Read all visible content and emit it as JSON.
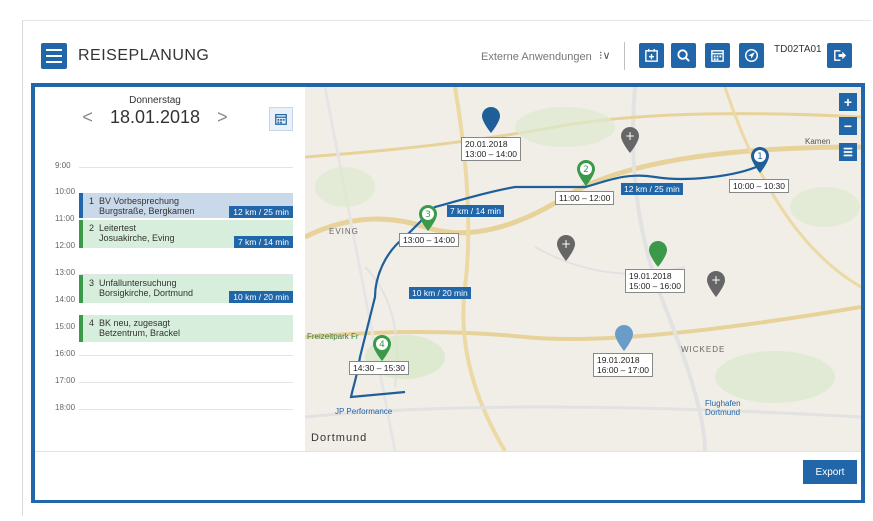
{
  "header": {
    "title": "REISEPLANUNG",
    "external_apps_label": "Externe Anwendungen",
    "external_apps_caret": "⁝∨",
    "user_code": "TD02TA01",
    "icons": [
      "add-calendar-icon",
      "search-icon",
      "calendar-icon",
      "navigation-icon",
      "logout-icon"
    ]
  },
  "day": {
    "weekday": "Donnerstag",
    "date": "18.01.2018",
    "prev": "<",
    "next": ">"
  },
  "times": [
    "9:00",
    "10:00",
    "11:00",
    "12:00",
    "13:00",
    "14:00",
    "15:00",
    "16:00",
    "17:00",
    "18:00"
  ],
  "events": [
    {
      "num": "1",
      "title": "BV Vorbesprechung",
      "place": "Burgstraße, Bergkamen",
      "dist": "12 km / 25 min",
      "bg": "#c9d9ea",
      "bar": "#2066a8"
    },
    {
      "num": "2",
      "title": "Leitertest",
      "place": "Josuakirche, Eving",
      "dist": "7 km / 14 min",
      "bg": "#d6eedb",
      "bar": "#3a9a4a"
    },
    {
      "num": "3",
      "title": "Unfalluntersuchung",
      "place": "Borsigkirche, Dortmund",
      "dist": "10 km / 20 min",
      "bg": "#d6eedb",
      "bar": "#3a9a4a"
    },
    {
      "num": "4",
      "title": "BK neu, zugesagt",
      "place": "Betzentrum, Brackel",
      "dist": "",
      "bg": "#d6eedb",
      "bar": "#3a9a4a"
    }
  ],
  "map": {
    "zoom_in": "+",
    "zoom_out": "−",
    "labels": {
      "pin20": [
        "20.01.2018",
        "13:00 – 14:00"
      ],
      "pin1": "10:00 – 10:30",
      "pin2": "11:00 – 12:00",
      "pin3": "13:00 – 14:00",
      "pin4": "14:30 – 15:30",
      "pin19a": [
        "19.01.2018",
        "15:00 – 16:00"
      ],
      "pin19b": [
        "19.01.2018",
        "16:00 – 17:00"
      ]
    },
    "distances": {
      "d1": "12 km / 25 min",
      "d2": "7 km / 14 min",
      "d3": "10 km / 20 min"
    },
    "pin_numbers": [
      "1",
      "2",
      "3",
      "4"
    ],
    "places": {
      "eving": "EVING",
      "wickede": "WICKEDE",
      "dortmund": "Dortmund",
      "kamen": "Kamen",
      "flughafen": "Flughafen\nDortmund",
      "freizeitpark": "Freizeitpark Fr",
      "performance": "JP Performance"
    }
  },
  "footer": {
    "export": "Export"
  },
  "colors": {
    "primary": "#2066a8",
    "green": "#3a9a4a",
    "gray_pin": "#666666"
  }
}
